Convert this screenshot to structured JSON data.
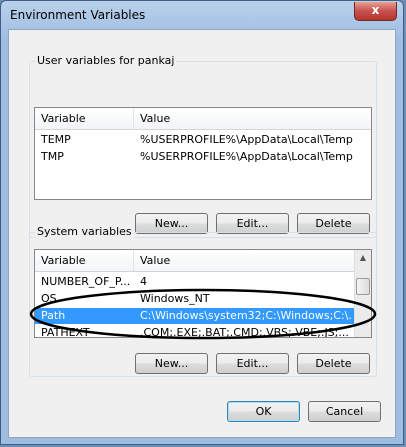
{
  "window": {
    "title": "Environment Variables",
    "close_glyph": "x"
  },
  "user_group": {
    "label": "User variables for pankaj",
    "columns": [
      "Variable",
      "Value"
    ],
    "rows": [
      {
        "variable": "TEMP",
        "value": "%USERPROFILE%\\AppData\\Local\\Temp"
      },
      {
        "variable": "TMP",
        "value": "%USERPROFILE%\\AppData\\Local\\Temp"
      }
    ],
    "buttons": {
      "new": "New...",
      "edit": "Edit...",
      "delete": "Delete"
    }
  },
  "system_group": {
    "label": "System variables",
    "columns": [
      "Variable",
      "Value"
    ],
    "rows": [
      {
        "variable": "NUMBER_OF_P...",
        "value": "4"
      },
      {
        "variable": "OS",
        "value": "Windows_NT"
      },
      {
        "variable": "Path",
        "value": "C:\\Windows\\system32;C:\\Windows;C:\\..."
      },
      {
        "variable": "PATHEXT",
        "value": ".COM;.EXE;.BAT;.CMD;.VBS;.VBE;.JS;..."
      }
    ],
    "selected_row": 2,
    "buttons": {
      "new": "New...",
      "edit": "Edit...",
      "delete": "Delete"
    }
  },
  "footer": {
    "ok": "OK",
    "cancel": "Cancel"
  },
  "colors": {
    "selection": "#3399ff",
    "annotation_ellipse": "#000000"
  }
}
